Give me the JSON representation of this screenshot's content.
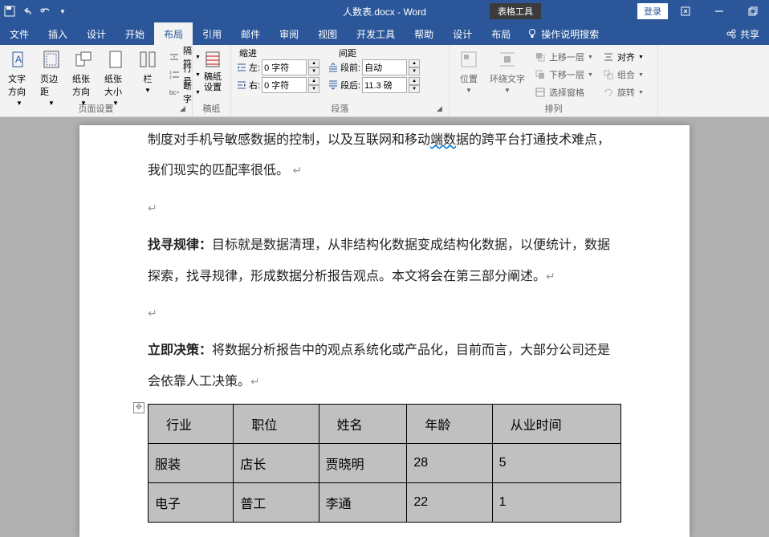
{
  "title_bar": {
    "doc_title": "人数表.docx - Word",
    "table_tools": "表格工具",
    "login": "登录"
  },
  "menu": {
    "file": "文件",
    "insert": "插入",
    "design": "设计",
    "home": "开始",
    "layout": "布局",
    "references": "引用",
    "mailings": "邮件",
    "review": "审阅",
    "view": "视图",
    "devtools": "开发工具",
    "help": "帮助",
    "table_design": "设计",
    "table_layout": "布局",
    "tell_me": "操作说明搜索",
    "share": "共享"
  },
  "ribbon": {
    "page_setup": {
      "text_direction": "文字方向",
      "margins": "页边距",
      "orientation": "纸张方向",
      "size": "纸张大小",
      "columns": "栏",
      "breaks": "隔符",
      "line_numbers": "行号",
      "hyphenation": "断字",
      "group_label": "页面设置"
    },
    "manuscript": {
      "settings": "稿纸设置",
      "group_label": "稿纸"
    },
    "paragraph": {
      "indent_label": "缩进",
      "spacing_label": "间距",
      "indent_left_label": "左:",
      "indent_right_label": "右:",
      "indent_left": "0 字符",
      "indent_right": "0 字符",
      "before_label": "段前:",
      "after_label": "段后:",
      "before": "自动",
      "after": "11.3 磅",
      "group_label": "段落"
    },
    "arrange": {
      "position": "位置",
      "wrap": "环绕文字",
      "bring_forward": "上移一层",
      "send_backward": "下移一层",
      "selection_pane": "选择窗格",
      "align": "对齐",
      "group": "组合",
      "rotate": "旋转",
      "group_label": "排列"
    }
  },
  "document": {
    "p1": "制度对手机号敏感数据的控制，以及互联网和移动",
    "p1_wavy": "端数",
    "p1_end": "据的跨平台打通技术难点，我们现实的匹配率很低。",
    "p2_strong": "找寻规律：",
    "p2": "目标就是数据清理，从非结构化数据变成结构化数据，以便统计，数据探索，找寻规律，形成数据分析报告观点。本文将会在第三部分阐述。",
    "p3_strong": "立即决策：",
    "p3": "将数据分析报告中的观点系统化或产品化，目前而言，大部分公司还是会依靠人工决策。"
  },
  "table": {
    "headers": [
      "行业",
      "职位",
      "姓名",
      "年龄",
      "从业时间"
    ],
    "rows": [
      [
        "服装",
        "店长",
        "贾晓明",
        "28",
        "5"
      ],
      [
        "电子",
        "普工",
        "李通",
        "22",
        "1"
      ]
    ]
  }
}
